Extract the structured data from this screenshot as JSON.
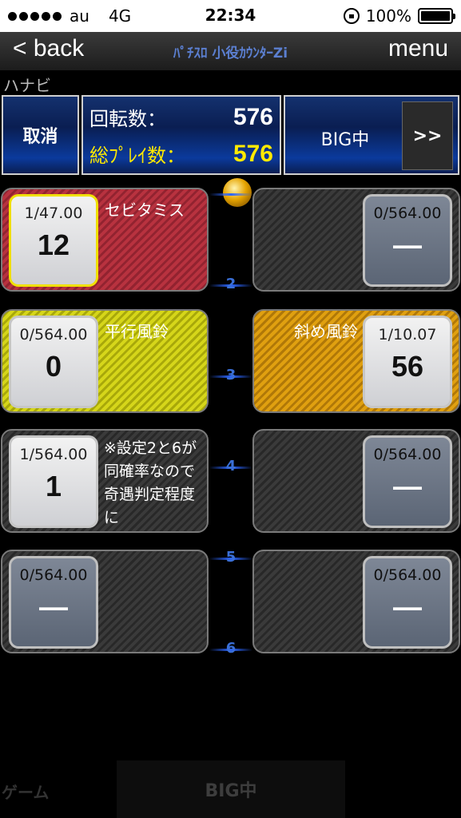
{
  "status": {
    "carrier": "au",
    "network": "4G",
    "time": "22:34",
    "battery": "100%"
  },
  "nav": {
    "back": "< back",
    "title": "ﾊﾟﾁｽﾛ 小役ｶｳﾝﾀｰZi",
    "menu": "menu"
  },
  "machine_name": "ハナビ",
  "header": {
    "cancel": "取消",
    "spins_label": "回転数：",
    "spins": "576",
    "total_label": "総ﾌﾟﾚｲ数：",
    "total": "576",
    "mode": "BIG中",
    "next": ">>"
  },
  "rail": [
    "2",
    "3",
    "4",
    "5",
    "6"
  ],
  "panels": [
    {
      "title": "セビタミス",
      "prob": "1/47.00",
      "count": "12"
    },
    {
      "title": "",
      "prob": "0/564.00",
      "count": "—"
    },
    {
      "title": "平行風鈴",
      "prob": "0/564.00",
      "count": "0"
    },
    {
      "title": "斜め風鈴",
      "prob": "1/10.07",
      "count": "56"
    },
    {
      "note": "※設定2と6が同確率なので奇遇判定程度に",
      "prob": "1/564.00",
      "count": "1"
    },
    {
      "title": "",
      "prob": "0/564.00",
      "count": "—"
    },
    {
      "title": "",
      "prob": "0/564.00",
      "count": "—"
    },
    {
      "title": "",
      "prob": "0/564.00",
      "count": "—"
    }
  ],
  "bottom": {
    "game": "ゲーム",
    "big": "BIG中"
  },
  "colors": {
    "accent": "#0b3a9c",
    "highlight": "#ffea00",
    "rail": "#2d66ff"
  }
}
